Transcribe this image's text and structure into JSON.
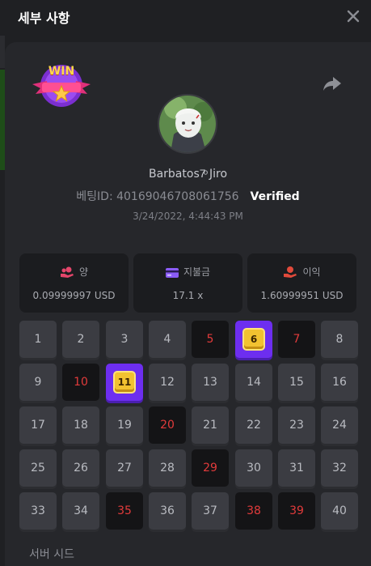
{
  "modal": {
    "title": "세부 사항"
  },
  "bet": {
    "username": "Barbatos7ͦ Jiro",
    "bet_id_label": "베팅ID: 40169046708061756",
    "verified": "Verified",
    "date": "3/24/2022, 4:44:43 PM",
    "win_badge_text": "WIN"
  },
  "stats": [
    {
      "label": "양",
      "value": "0.09999997 USD",
      "icon": "coins-hand-icon",
      "icon_color": "#e5466b"
    },
    {
      "label": "지불금",
      "value": "17.1 x",
      "icon": "card-icon",
      "icon_color": "#8b5cf6"
    },
    {
      "label": "이익",
      "value": "1.60999951 USD",
      "icon": "money-hand-icon",
      "icon_color": "#e24a3b"
    }
  ],
  "grid": {
    "numbers": [
      "1",
      "2",
      "3",
      "4",
      "5",
      "6",
      "7",
      "8",
      "9",
      "10",
      "11",
      "12",
      "13",
      "14",
      "15",
      "16",
      "17",
      "18",
      "19",
      "20",
      "21",
      "22",
      "23",
      "24",
      "25",
      "26",
      "27",
      "28",
      "29",
      "30",
      "31",
      "32",
      "33",
      "34",
      "35",
      "36",
      "37",
      "38",
      "39",
      "40"
    ],
    "drawn": [
      "5",
      "7",
      "10",
      "20",
      "29",
      "35",
      "38",
      "39"
    ],
    "hits": [
      "6",
      "11"
    ]
  },
  "footer": {
    "server_seed_label": "서버 시드"
  },
  "colors": {
    "accent_purple": "#6d2ef0",
    "drawn_red": "#e23b3b",
    "gem_gold": "#f2c230",
    "panel": "#26272b",
    "background": "#1f2023"
  }
}
